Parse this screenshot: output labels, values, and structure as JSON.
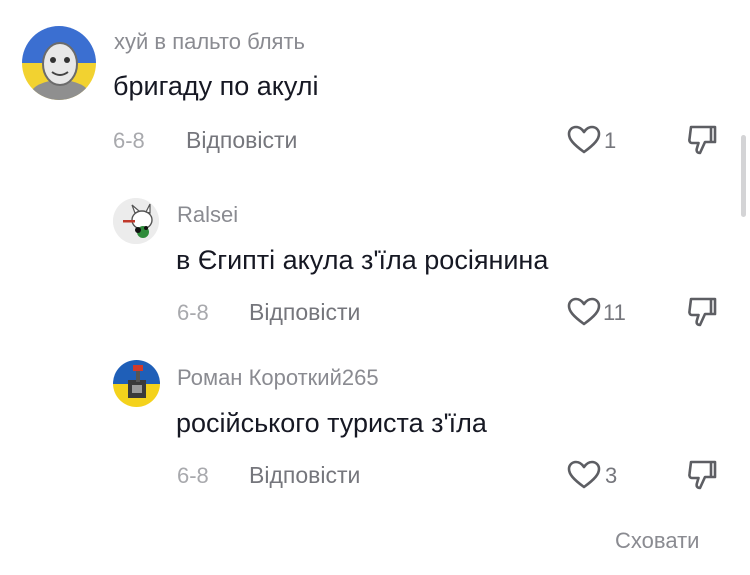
{
  "comments": [
    {
      "username": "хуй в пальто блять",
      "text": "бригаду по акулі",
      "date": "6-8",
      "reply_label": "Відповісти",
      "likes": "1"
    },
    {
      "username": "Ralsei",
      "text": "в Єгипті акула з'їла росіянина",
      "date": "6-8",
      "reply_label": "Відповісти",
      "likes": "11"
    },
    {
      "username": "Роман Короткий265",
      "text": "російського туриста з'їла",
      "date": "6-8",
      "reply_label": "Відповісти",
      "likes": "3"
    }
  ],
  "hide_label": "Сховати",
  "icons": {
    "like": "heart-outline-icon",
    "dislike": "thumbs-down-icon"
  },
  "colors": {
    "flag_blue": "#0057b7",
    "flag_yellow": "#ffd700",
    "text": "#161823",
    "muted": "#8a8b91"
  }
}
